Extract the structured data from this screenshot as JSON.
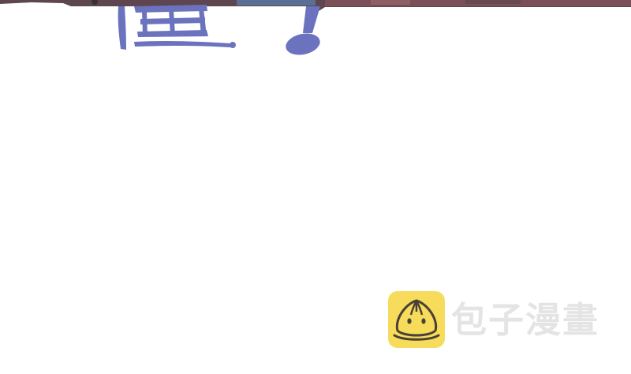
{
  "watermark": {
    "text": "包子漫畫",
    "logo_icon": "bun-mascot-icon"
  },
  "colors": {
    "background": "#ffffff",
    "brush_text": "#6b73bf",
    "logo_yellow": "#f6dc5a",
    "watermark_text": "#e4e4e4"
  }
}
